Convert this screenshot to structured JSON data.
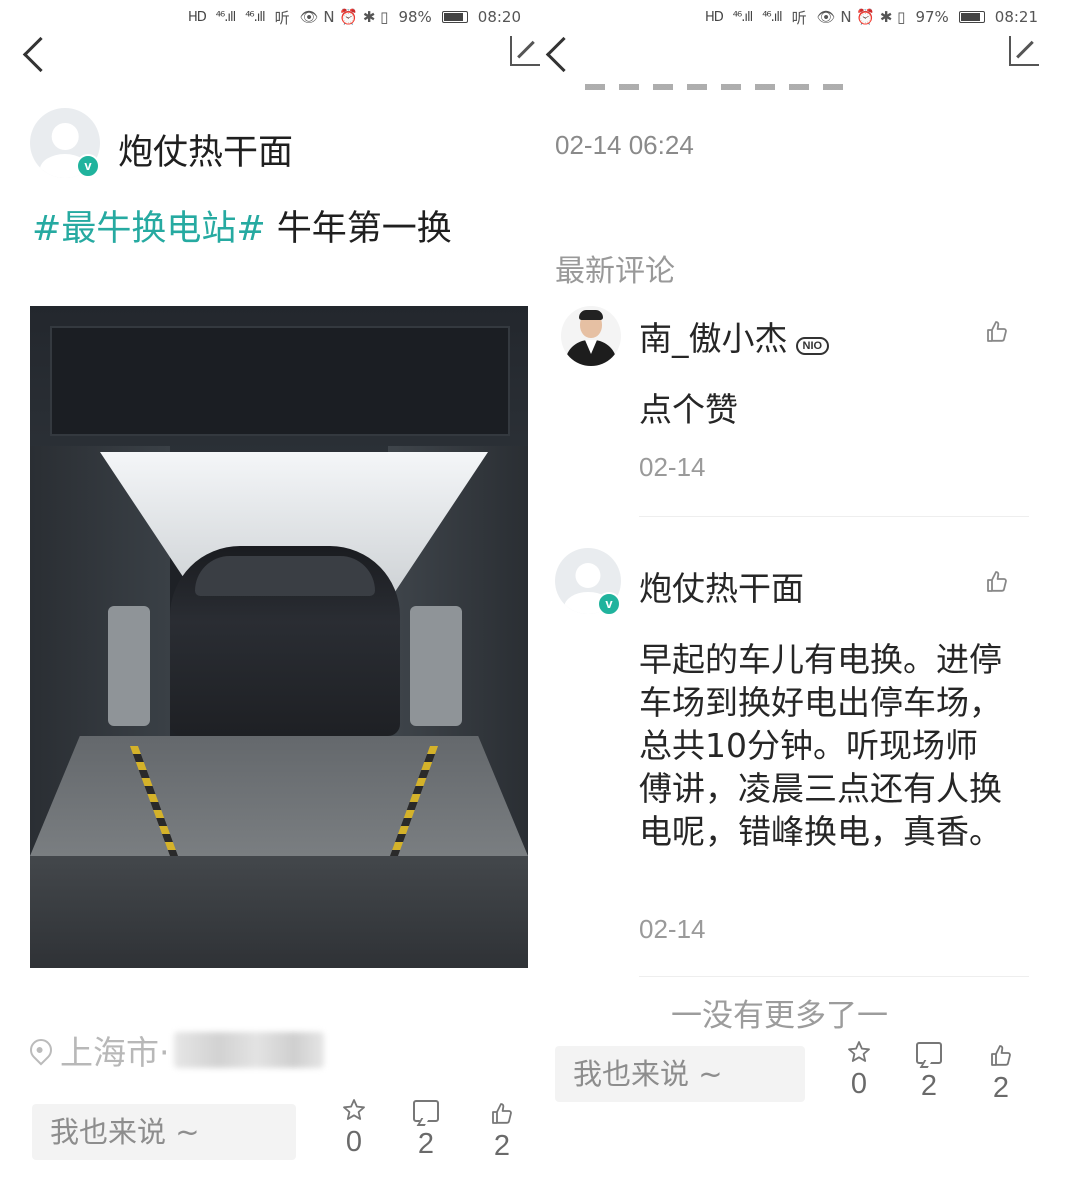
{
  "left": {
    "status": {
      "hd": "HD",
      "sig1": "⁴⁶.ıll",
      "sig2": "⁴⁶.ıll",
      "extra": "听",
      "icons": "👁 N ⏰ ✱ ▯",
      "battery": "98%",
      "time": "08:20"
    },
    "post": {
      "author": "炮仗热干面",
      "verify_badge": "v",
      "hashtag": "#最牛换电站#",
      "text": " 牛年第一换",
      "location": "上海市·"
    },
    "comment_placeholder": "我也来说 ~",
    "actions": {
      "favorite_count": "0",
      "comment_count": "2",
      "like_count": "2"
    }
  },
  "right": {
    "status": {
      "hd": "HD",
      "sig1": "⁴⁶.ıll",
      "sig2": "⁴⁶.ıll",
      "extra": "听",
      "icons": "👁 N ⏰ ✱ ▯",
      "battery": "97%",
      "time": "08:21"
    },
    "post_time": "02-14 06:24",
    "section_title": "最新评论",
    "comments": [
      {
        "name": "南_傲小杰",
        "badge": "NIO",
        "text": "点个赞",
        "time": "02-14"
      },
      {
        "name": "炮仗热干面",
        "badge": "v",
        "text": "早起的车儿有电换。进停车场到换好电出停车场，总共10分钟。听现场师傅讲，凌晨三点还有人换电呢，错峰换电，真香。",
        "time": "02-14"
      }
    ],
    "no_more": "一没有更多了一",
    "comment_placeholder": "我也来说 ~",
    "actions": {
      "favorite_count": "0",
      "comment_count": "2",
      "like_count": "2"
    }
  },
  "icons": {
    "back": "chevron-left-icon",
    "share": "share-icon",
    "location": "location-pin-icon",
    "favorite": "star-icon",
    "comment": "comment-icon",
    "like": "thumbs-up-icon"
  },
  "colors": {
    "hashtag": "#26aaa1",
    "verify": "#20b39d"
  }
}
